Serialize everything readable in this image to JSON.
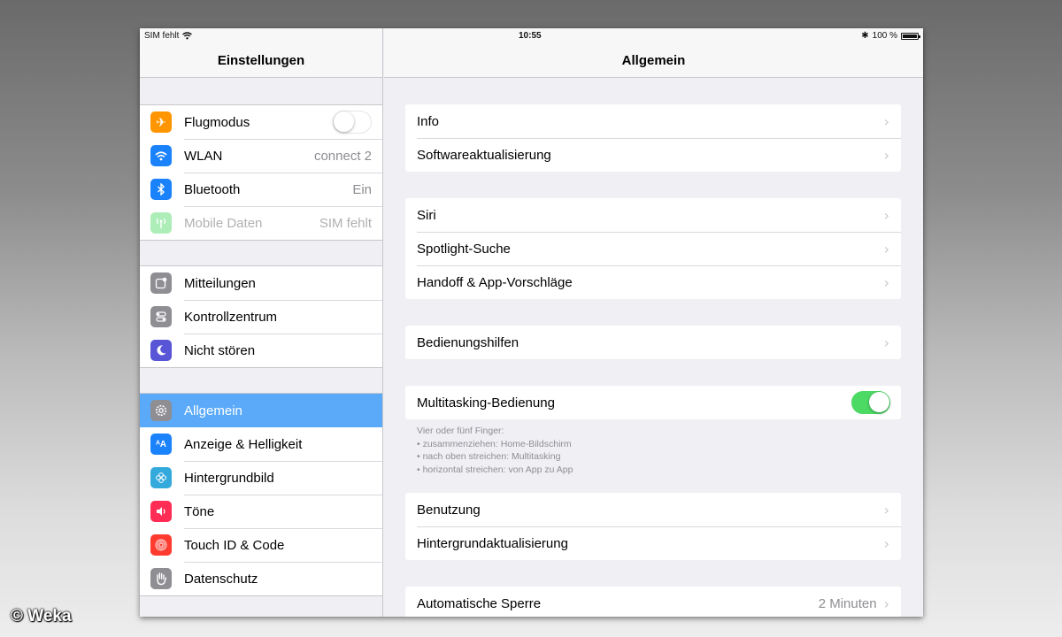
{
  "status": {
    "carrier": "SIM fehlt",
    "time": "10:55",
    "battery": "100 %"
  },
  "sidebar": {
    "title": "Einstellungen",
    "group1": [
      {
        "label": "Flugmodus",
        "icon": "airplane-icon",
        "color": "#ff9500",
        "toggle": false
      },
      {
        "label": "WLAN",
        "icon": "wifi-icon",
        "color": "#1a82fb",
        "value": "connect 2"
      },
      {
        "label": "Bluetooth",
        "icon": "bluetooth-icon",
        "color": "#1a82fb",
        "value": "Ein"
      },
      {
        "label": "Mobile Daten",
        "icon": "antenna-icon",
        "color": "#4cd964",
        "value": "SIM fehlt",
        "disabled": true
      }
    ],
    "group2": [
      {
        "label": "Mitteilungen",
        "icon": "notifications-icon",
        "color": "#8e8e93"
      },
      {
        "label": "Kontrollzentrum",
        "icon": "control-center-icon",
        "color": "#8e8e93"
      },
      {
        "label": "Nicht stören",
        "icon": "moon-icon",
        "color": "#5856d6"
      }
    ],
    "group3": [
      {
        "label": "Allgemein",
        "icon": "gear-icon",
        "color": "#8e8e93",
        "selected": true
      },
      {
        "label": "Anzeige & Helligkeit",
        "icon": "text-size-icon",
        "color": "#1a82fb"
      },
      {
        "label": "Hintergrundbild",
        "icon": "wallpaper-icon",
        "color": "#34aadc"
      },
      {
        "label": "Töne",
        "icon": "speaker-icon",
        "color": "#ff2d55"
      },
      {
        "label": "Touch ID & Code",
        "icon": "fingerprint-icon",
        "color": "#ff3b30"
      },
      {
        "label": "Datenschutz",
        "icon": "hand-icon",
        "color": "#8e8e93"
      }
    ]
  },
  "main": {
    "title": "Allgemein",
    "card1": [
      {
        "label": "Info"
      },
      {
        "label": "Softwareaktualisierung"
      }
    ],
    "card2": [
      {
        "label": "Siri"
      },
      {
        "label": "Spotlight-Suche"
      },
      {
        "label": "Handoff & App-Vorschläge"
      }
    ],
    "card3": [
      {
        "label": "Bedienungshilfen"
      }
    ],
    "card4": [
      {
        "label": "Multitasking-Bedienung",
        "toggle": true
      }
    ],
    "multitasking_note": [
      "Vier oder fünf Finger:",
      "• zusammenziehen: Home-Bildschirm",
      "• nach oben streichen: Multitasking",
      "• horizontal streichen: von App zu App"
    ],
    "card5": [
      {
        "label": "Benutzung"
      },
      {
        "label": "Hintergrundaktualisierung"
      }
    ],
    "card6": [
      {
        "label": "Automatische Sperre",
        "value": "2 Minuten"
      }
    ]
  },
  "watermark": "© Weka",
  "chevron": "›"
}
